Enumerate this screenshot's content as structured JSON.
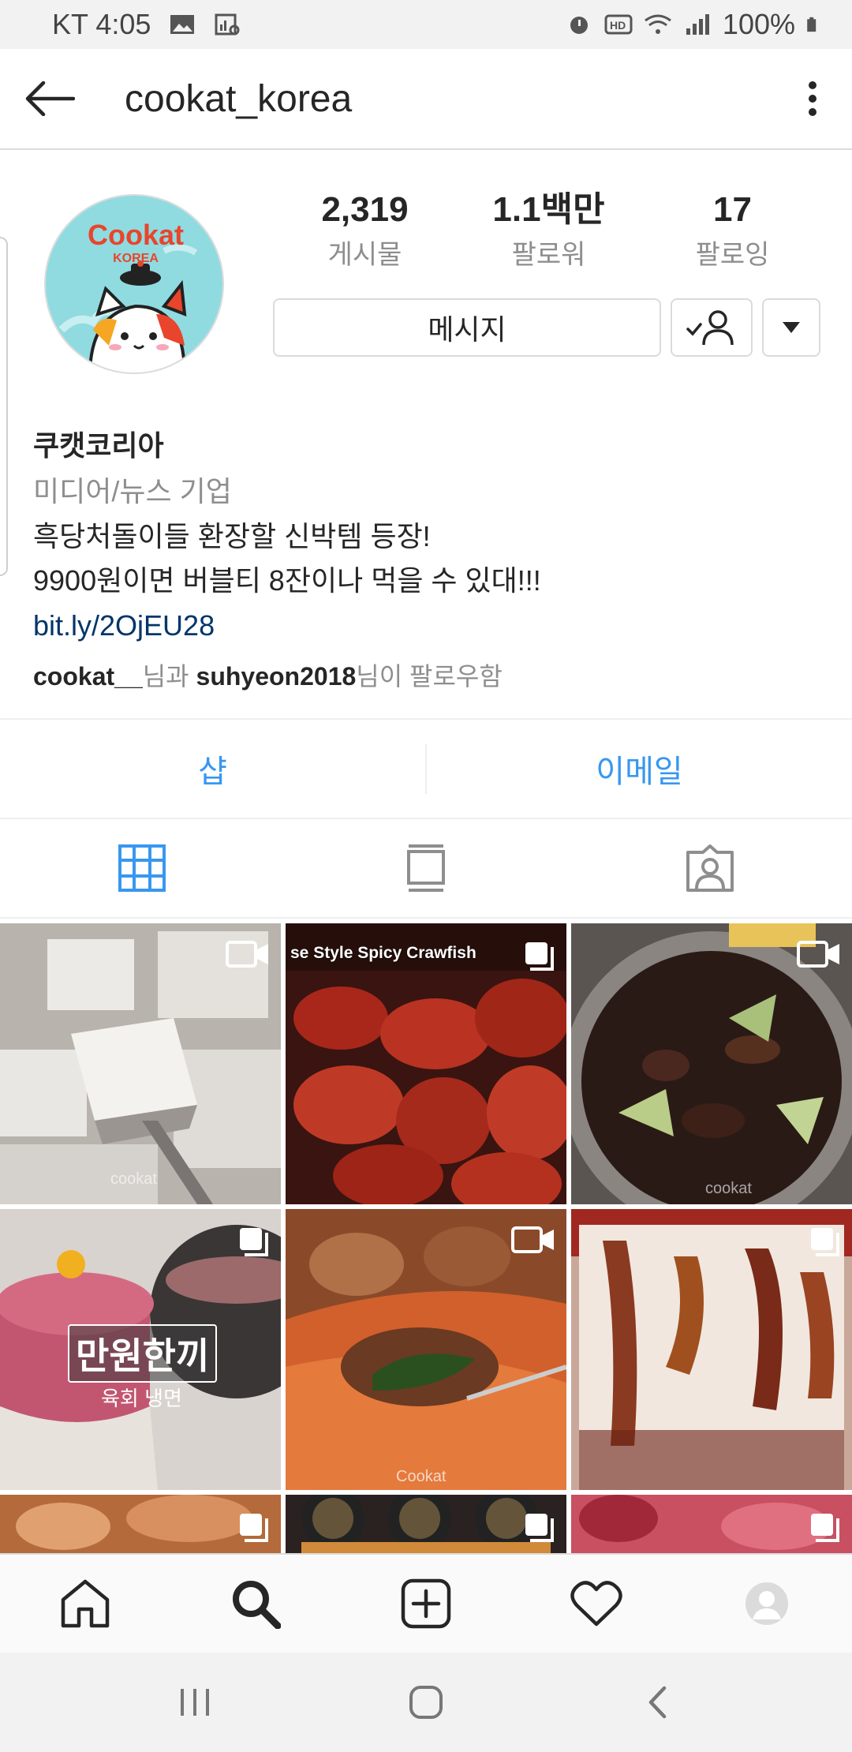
{
  "status_bar": {
    "carrier_time": "KT 4:05",
    "battery": "100%"
  },
  "appbar": {
    "title": "cookat_korea"
  },
  "avatar": {
    "brand_text": "Cookat",
    "brand_sub": "KOREA"
  },
  "stats": [
    {
      "value": "2,319",
      "label": "게시물"
    },
    {
      "value": "1.1백만",
      "label": "팔로워"
    },
    {
      "value": "17",
      "label": "팔로잉"
    }
  ],
  "buttons": {
    "message": "메시지"
  },
  "bio": {
    "name": "쿠캣코리아",
    "category": "미디어/뉴스 기업",
    "line1": "흑당처돌이들 환장할 신박템 등장!",
    "line2": "9900원이면 버블티 8잔이나 먹을 수 있대!!!",
    "link": "bit.ly/2OjEU28"
  },
  "followed_by": {
    "user1": "cookat__",
    "join": "님과 ",
    "user2": "suhyeon2018",
    "suffix": "님이 팔로우함"
  },
  "actions": {
    "shop": "샵",
    "email": "이메일"
  },
  "grid": {
    "captions": {
      "crawfish": "se Style Spicy Crawfish",
      "overlay_title": "만원한끼",
      "overlay_sub": "육회 냉면"
    },
    "items": [
      {
        "type": "video"
      },
      {
        "type": "carousel"
      },
      {
        "type": "video"
      },
      {
        "type": "carousel"
      },
      {
        "type": "video"
      },
      {
        "type": "carousel"
      },
      {
        "type": "carousel"
      },
      {
        "type": "carousel"
      },
      {
        "type": "carousel"
      }
    ]
  },
  "colors": {
    "accent_blue": "#3897f0",
    "link_blue": "#003569",
    "muted_grey": "#8e8e8e",
    "brand_red": "#e8452c",
    "avatar_bg": "#8fdbe0"
  }
}
